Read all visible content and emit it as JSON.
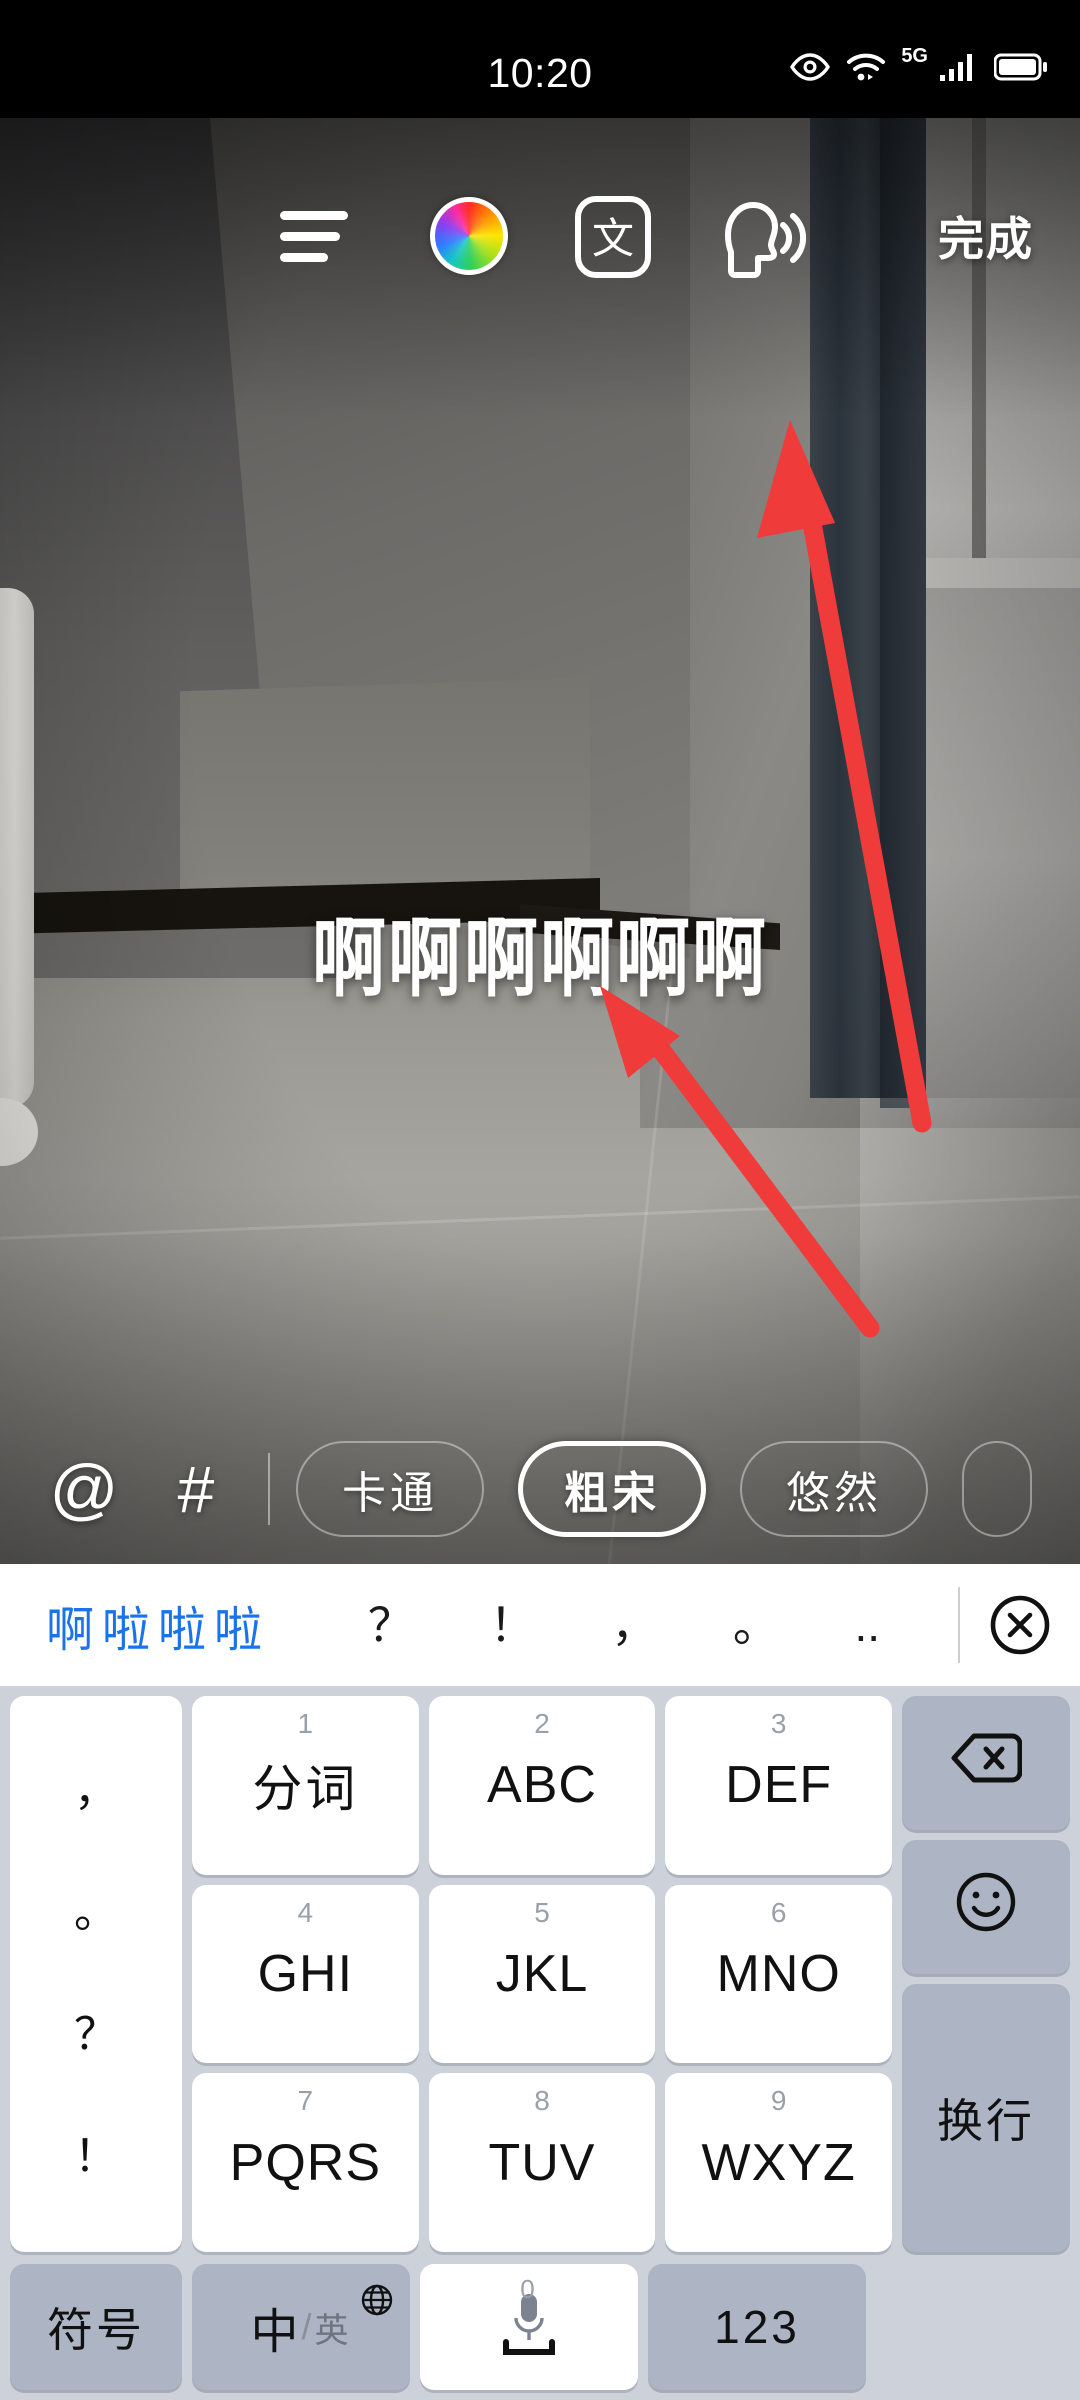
{
  "status_bar": {
    "time": "10:20",
    "network": "5G",
    "icons": [
      "eye-care-icon",
      "wifi-icon",
      "signal-icon",
      "battery-icon"
    ]
  },
  "editor": {
    "toolbar": {
      "align_icon": "text-align-icon",
      "color_icon": "color-wheel-icon",
      "translate_icon": "translate-icon",
      "translate_glyph": "文",
      "speak_icon": "text-to-speech-icon",
      "done_label": "完成"
    },
    "overlay_text": "啊啊啊啊啊啊",
    "annotations": {
      "arrow_color": "#f03b3b",
      "arrows": [
        "arrow-to-speech-icon",
        "arrow-to-overlay-text"
      ]
    },
    "fontbar": {
      "mention_label": "@",
      "hashtag_label": "#",
      "fonts": [
        {
          "label": "卡通",
          "selected": false
        },
        {
          "label": "粗宋",
          "selected": true
        },
        {
          "label": "悠然",
          "selected": false
        },
        {
          "label": "",
          "selected": false
        }
      ]
    }
  },
  "keyboard": {
    "candidates": {
      "primary": "啊啦啦啦",
      "primary_color": "#1a73e8",
      "punctuation": [
        "？",
        "！",
        "，",
        "。",
        ".."
      ],
      "close_icon": "close-circle-icon"
    },
    "punct_column": [
      "，",
      "。",
      "？",
      "！"
    ],
    "keys": [
      {
        "num": "1",
        "label": "分词",
        "cn": true
      },
      {
        "num": "2",
        "label": "ABC",
        "cn": false
      },
      {
        "num": "3",
        "label": "DEF",
        "cn": false
      },
      {
        "num": "4",
        "label": "GHI",
        "cn": false
      },
      {
        "num": "5",
        "label": "JKL",
        "cn": false
      },
      {
        "num": "6",
        "label": "MNO",
        "cn": false
      },
      {
        "num": "7",
        "label": "PQRS",
        "cn": false
      },
      {
        "num": "8",
        "label": "TUV",
        "cn": false
      },
      {
        "num": "9",
        "label": "WXYZ",
        "cn": false
      }
    ],
    "right_column": {
      "backspace_icon": "backspace-icon",
      "emoji_icon": "emoji-smiley-icon",
      "enter_label": "换行"
    },
    "bottom_row": {
      "symbol_label": "符号",
      "lang_cn": "中",
      "lang_slash": "/",
      "lang_en": "英",
      "globe_icon": "globe-icon",
      "space_zero": "0",
      "mic_icon": "microphone-icon",
      "numeric_label": "123"
    }
  }
}
